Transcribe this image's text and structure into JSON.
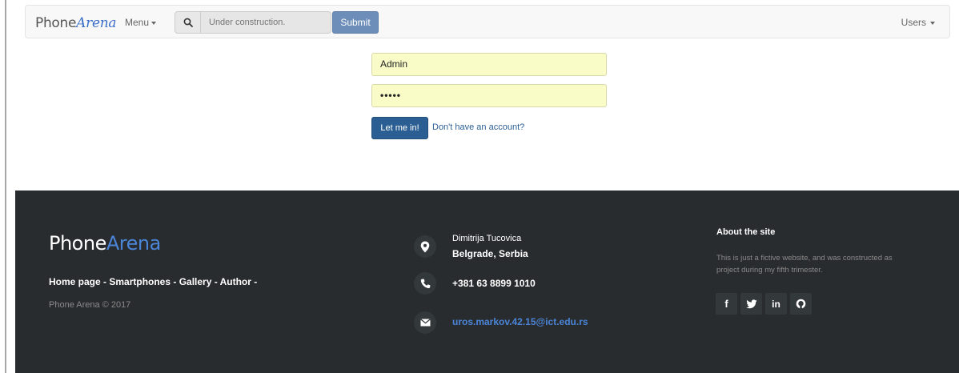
{
  "navbar": {
    "brand_phone": "Phone",
    "brand_arena": "Arena",
    "menu_label": "Menu",
    "search_placeholder": "Under construction.",
    "submit_label": "Submit",
    "users_label": "Users"
  },
  "login": {
    "username_value": "Admin",
    "password_value": "•••••",
    "login_label": "Let me in!",
    "register_link": "Don't have an account?"
  },
  "footer": {
    "logo_phone": "Phone",
    "logo_arena": "Arena",
    "links": "Home page - Smartphones - Gallery - Author -",
    "copyright": "Phone Arena © 2017",
    "address_street": "Dimitrija Tucovica",
    "address_city": "Belgrade, Serbia",
    "phone": "+381 63 8899 1010",
    "email": "uros.markov.42.15@ict.edu.rs",
    "about_title": "About the site",
    "about_text": "This is just a fictive website, and was constructed as project during my fifth trimester.",
    "social_icons": [
      "facebook-icon",
      "twitter-icon",
      "linkedin-icon",
      "github-icon"
    ]
  },
  "colors": {
    "accent": "#2b5f94",
    "footer_bg": "#292c2f",
    "brand_blue": "#4a85d8",
    "autofill_yellow": "#fafcc8"
  }
}
